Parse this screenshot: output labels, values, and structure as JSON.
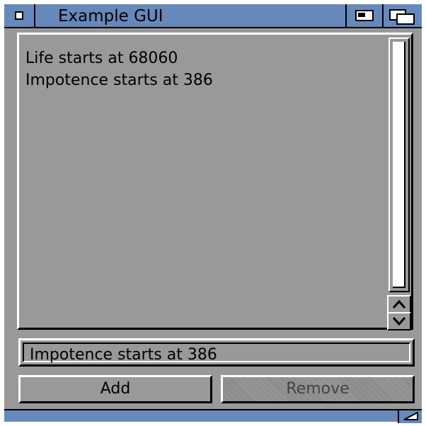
{
  "window": {
    "title": "Example GUI"
  },
  "list": {
    "items": [
      "Life starts at 68060",
      "Impotence starts at 386"
    ]
  },
  "input": {
    "value": "Impotence starts at 386"
  },
  "buttons": {
    "add_label": "Add",
    "remove_label": "Remove"
  },
  "icons": {
    "close": "close-icon",
    "zoom": "zoom-icon",
    "depth": "depth-icon",
    "scroll_up": "chevron-up-icon",
    "scroll_down": "chevron-down-icon",
    "size": "resize-icon"
  },
  "colors": {
    "titlebar": "#6688bb",
    "window_bg": "#999999",
    "highlight": "#ffffff",
    "shadow": "#000000"
  }
}
